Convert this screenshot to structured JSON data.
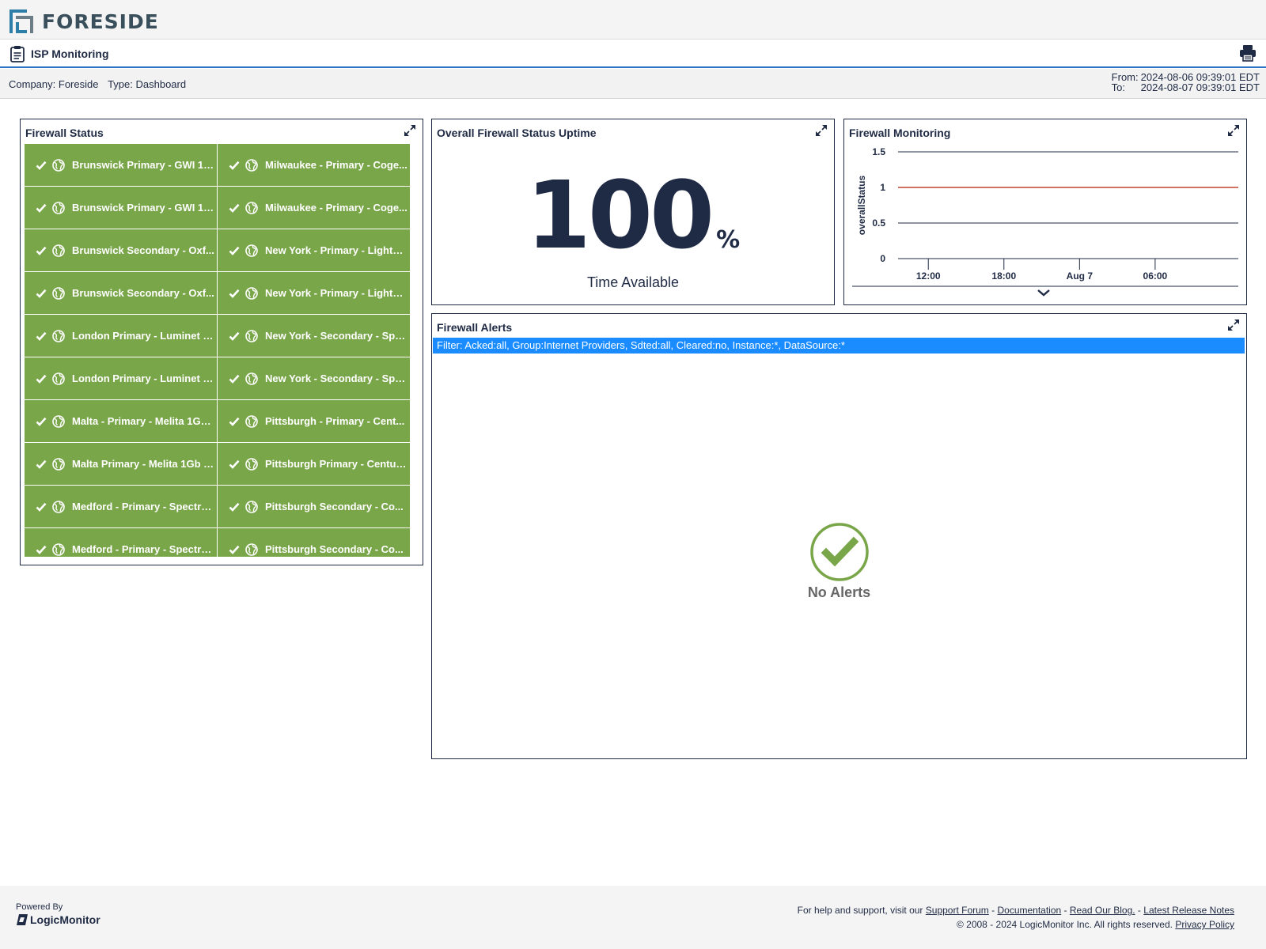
{
  "brand": {
    "name": "FORESIDE",
    "logo_color": "#2e7fa8"
  },
  "header": {
    "title": "ISP Monitoring",
    "print_icon": "printer-icon"
  },
  "info": {
    "company_label": "Company:",
    "company": "Foreside",
    "type_label": "Type:",
    "type": "Dashboard",
    "from_label": "From:",
    "from": "2024-08-06 09:39:01 EDT",
    "to_label": "To:",
    "to": "2024-08-07 09:39:01 EDT"
  },
  "widgets": {
    "firewall_status": {
      "title": "Firewall Status",
      "status_color": "#7aa64a",
      "items": [
        "Brunswick Primary - GWI 10...",
        "Milwaukee - Primary - Coge...",
        "Brunswick Primary - GWI 10...",
        "Milwaukee - Primary - Coge...",
        "Brunswick Secondary - Oxf...",
        "New York - Primary - Lightp...",
        "Brunswick Secondary - Oxf...",
        "New York - Primary - Lightp...",
        "London Primary - Luminet 1...",
        "New York - Secondary - Spe...",
        "London Primary - Luminet 1...",
        "New York - Secondary - Spe...",
        "Malta - Primary - Melita 1Gb...",
        "Pittsburgh - Primary - Cent...",
        "Malta Primary - Melita 1Gb -...",
        "Pittsburgh Primary - Centur...",
        "Medford - Primary - Spectru...",
        "Pittsburgh Secondary - Co...",
        "Medford - Primary - Spectru...",
        "Pittsburgh Secondary - Co..."
      ]
    },
    "uptime": {
      "title": "Overall Firewall Status Uptime",
      "value": "100",
      "unit": "%",
      "label": "Time Available"
    },
    "monitoring": {
      "title": "Firewall Monitoring"
    },
    "alerts": {
      "title": "Firewall Alerts",
      "filter": "Filter: Acked:all, Group:Internet Providers, Sdted:all, Cleared:no, Instance:*, DataSource:*",
      "empty_text": "No Alerts",
      "ok_color": "#7aa64a",
      "filter_color": "#1a8cff"
    }
  },
  "chart_data": {
    "type": "line",
    "title": "Firewall Monitoring",
    "ylabel": "overallStatus",
    "xlabel": "",
    "ylim": [
      0,
      1.5
    ],
    "yticks": [
      "1.5",
      "1",
      "0.5",
      "0"
    ],
    "ytick_values": [
      1.5,
      1,
      0.5,
      0
    ],
    "xticks": [
      "12:00",
      "18:00",
      "Aug 7",
      "06:00"
    ],
    "x": [
      "2024-08-06 09:39",
      "2024-08-07 09:39"
    ],
    "series": [
      {
        "values": [
          1,
          1
        ],
        "color": "#c0452b"
      }
    ],
    "grid": true
  },
  "footer": {
    "powered_by": "Powered By",
    "vendor": "LogicMonitor",
    "help_prefix": "For help and support, visit our",
    "links": [
      "Support Forum",
      "Documentation",
      "Read Our Blog.",
      "Latest Release Notes"
    ],
    "copyright": "© 2008 - 2024 LogicMonitor Inc. All rights reserved.",
    "privacy": "Privacy Policy"
  }
}
